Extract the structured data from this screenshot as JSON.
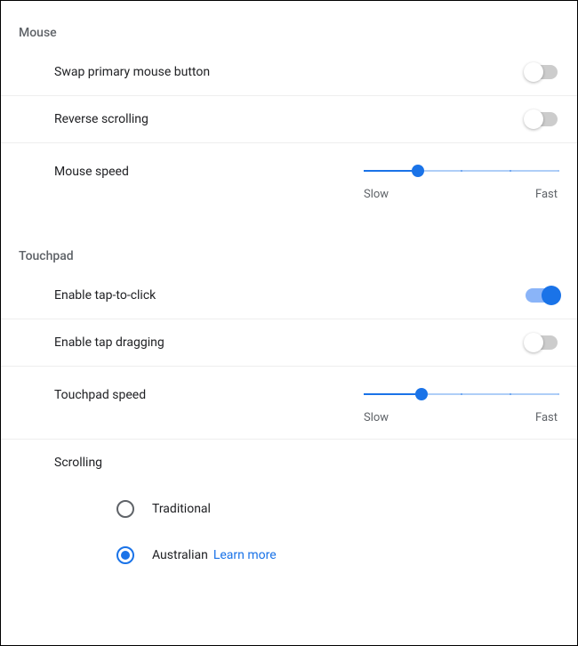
{
  "mouse": {
    "header": "Mouse",
    "swap_label": "Swap primary mouse button",
    "swap_on": false,
    "reverse_label": "Reverse scrolling",
    "reverse_on": false,
    "speed_label": "Mouse speed",
    "speed_value": 28,
    "speed_min_label": "Slow",
    "speed_max_label": "Fast"
  },
  "touchpad": {
    "header": "Touchpad",
    "tap_label": "Enable tap-to-click",
    "tap_on": true,
    "drag_label": "Enable tap dragging",
    "drag_on": false,
    "speed_label": "Touchpad speed",
    "speed_value": 30,
    "speed_min_label": "Slow",
    "speed_max_label": "Fast",
    "scrolling_header": "Scrolling",
    "radios": {
      "traditional": {
        "label": "Traditional",
        "checked": false
      },
      "australian": {
        "label": "Australian",
        "checked": true,
        "learn_more": "Learn more"
      }
    }
  }
}
